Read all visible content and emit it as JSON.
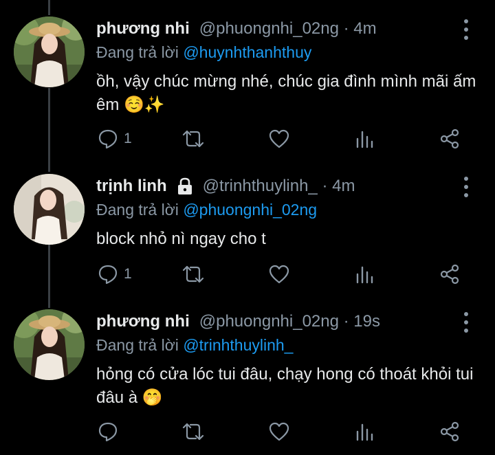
{
  "colors": {
    "accent": "#1d9bf0",
    "muted": "#8b98a5",
    "text": "#e7e9ea",
    "bg": "#000000"
  },
  "tweets": [
    {
      "name": "phương nhi",
      "handle": "@phuongnhi_02ng · 4m",
      "reply_prefix": "Đang trả lời",
      "reply_to": "@huynhthanhthuy",
      "text": "ồh, vậy chúc mừng nhé, chúc gia đình mình mãi ấm êm ☺️✨",
      "reply_count": "1",
      "locked": false
    },
    {
      "name": "trịnh linh",
      "handle": "@trinhthuylinh_ · 4m",
      "reply_prefix": "Đang trả lời",
      "reply_to": "@phuongnhi_02ng",
      "text": "block nhỏ nì ngay cho t",
      "reply_count": "1",
      "locked": true
    },
    {
      "name": "phương nhi",
      "handle": "@phuongnhi_02ng · 19s",
      "reply_prefix": "Đang trả lời",
      "reply_to": "@trinhthuylinh_",
      "text": "hỏng có cửa lóc tui đâu, chạy hong có thoát khỏi tui đâu à 🤭",
      "reply_count": "",
      "locked": false
    }
  ],
  "icons": {
    "reply": "reply-bubble-icon",
    "retweet": "retweet-icon",
    "like": "heart-icon",
    "analytics": "analytics-bars-icon",
    "share": "share-icon",
    "more": "more-vertical-icon",
    "lock": "lock-icon"
  }
}
